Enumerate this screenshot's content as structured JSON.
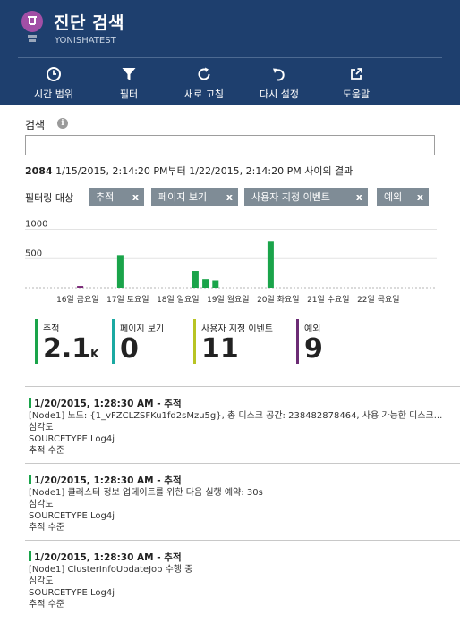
{
  "header": {
    "title": "진단 검색",
    "subtitle": "YONISHATEST",
    "bg_color": "#1e3f6e"
  },
  "toolbar": {
    "items": [
      {
        "label": "시간 범위",
        "icon": "clock-icon"
      },
      {
        "label": "필터",
        "icon": "filter-icon"
      },
      {
        "label": "새로 고침",
        "icon": "refresh-icon"
      },
      {
        "label": "다시 설정",
        "icon": "reset-icon"
      },
      {
        "label": "도움말",
        "icon": "external-link-icon"
      }
    ]
  },
  "search": {
    "label": "검색",
    "value": "",
    "placeholder": ""
  },
  "results": {
    "count": "2084",
    "text": "1/15/2015, 2:14:20 PM부터 1/22/2015, 2:14:20 PM 사이의 결과"
  },
  "filters": {
    "label": "필터링 대상",
    "chips": [
      "추적",
      "페이지 보기",
      "사용자 지정 이벤트",
      "예외"
    ],
    "close_glyph": "x"
  },
  "chart_data": {
    "type": "bar",
    "title": "",
    "xlabel": "",
    "ylabel": "",
    "ylim": [
      0,
      1100
    ],
    "yticks": [
      "1000",
      "500"
    ],
    "categories": [
      "16일 금요일",
      "17일 토요일",
      "18일 일요일",
      "19일 월요일",
      "20일 화요일",
      "21일 수요일",
      "22일 목요일"
    ],
    "bars": [
      {
        "x": 0.1,
        "value": 30,
        "color": "#7b2b79"
      },
      {
        "x": 0.9,
        "value": 560,
        "color": "#1aa44a"
      },
      {
        "x": 2.4,
        "value": 290,
        "color": "#1aa44a"
      },
      {
        "x": 2.6,
        "value": 150,
        "color": "#1aa44a"
      },
      {
        "x": 2.8,
        "value": 130,
        "color": "#1aa44a"
      },
      {
        "x": 3.9,
        "value": 790,
        "color": "#1aa44a"
      }
    ]
  },
  "tiles": [
    {
      "name": "추적",
      "value": "2.1",
      "unit": "K",
      "color": "#1aa44a"
    },
    {
      "name": "페이지 보기",
      "value": "0",
      "unit": "",
      "color": "#1ba9a2"
    },
    {
      "name": "사용자 지정 이벤트",
      "value": "11",
      "unit": "",
      "color": "#b8c424"
    },
    {
      "name": "예외",
      "value": "9",
      "unit": "",
      "color": "#6b2b74"
    }
  ],
  "events": [
    {
      "header": "1/20/2015, 1:28:30 AM - 추적",
      "message": "[Node1] 노드: {1_vFZCLZSFKu1fd2sMzu5g}, 총 디스크 공간: 238482878464, 사용 가능한 디스크...",
      "severity": "심각도",
      "source": "SOURCETYPE Log4j",
      "level": "추적 수준"
    },
    {
      "header": "1/20/2015, 1:28:30 AM - 추적",
      "message": "[Node1] 클러스터 정보 업데이트를 위한 다음 실행 예약: 30s",
      "severity": "심각도",
      "source": "SOURCETYPE Log4j",
      "level": "추적 수준"
    },
    {
      "header": "1/20/2015, 1:28:30 AM - 추적",
      "message": "[Node1] ClusterInfoUpdateJob 수행 중",
      "severity": "심각도",
      "source": "SOURCETYPE Log4j",
      "level": "추적 수준"
    }
  ]
}
